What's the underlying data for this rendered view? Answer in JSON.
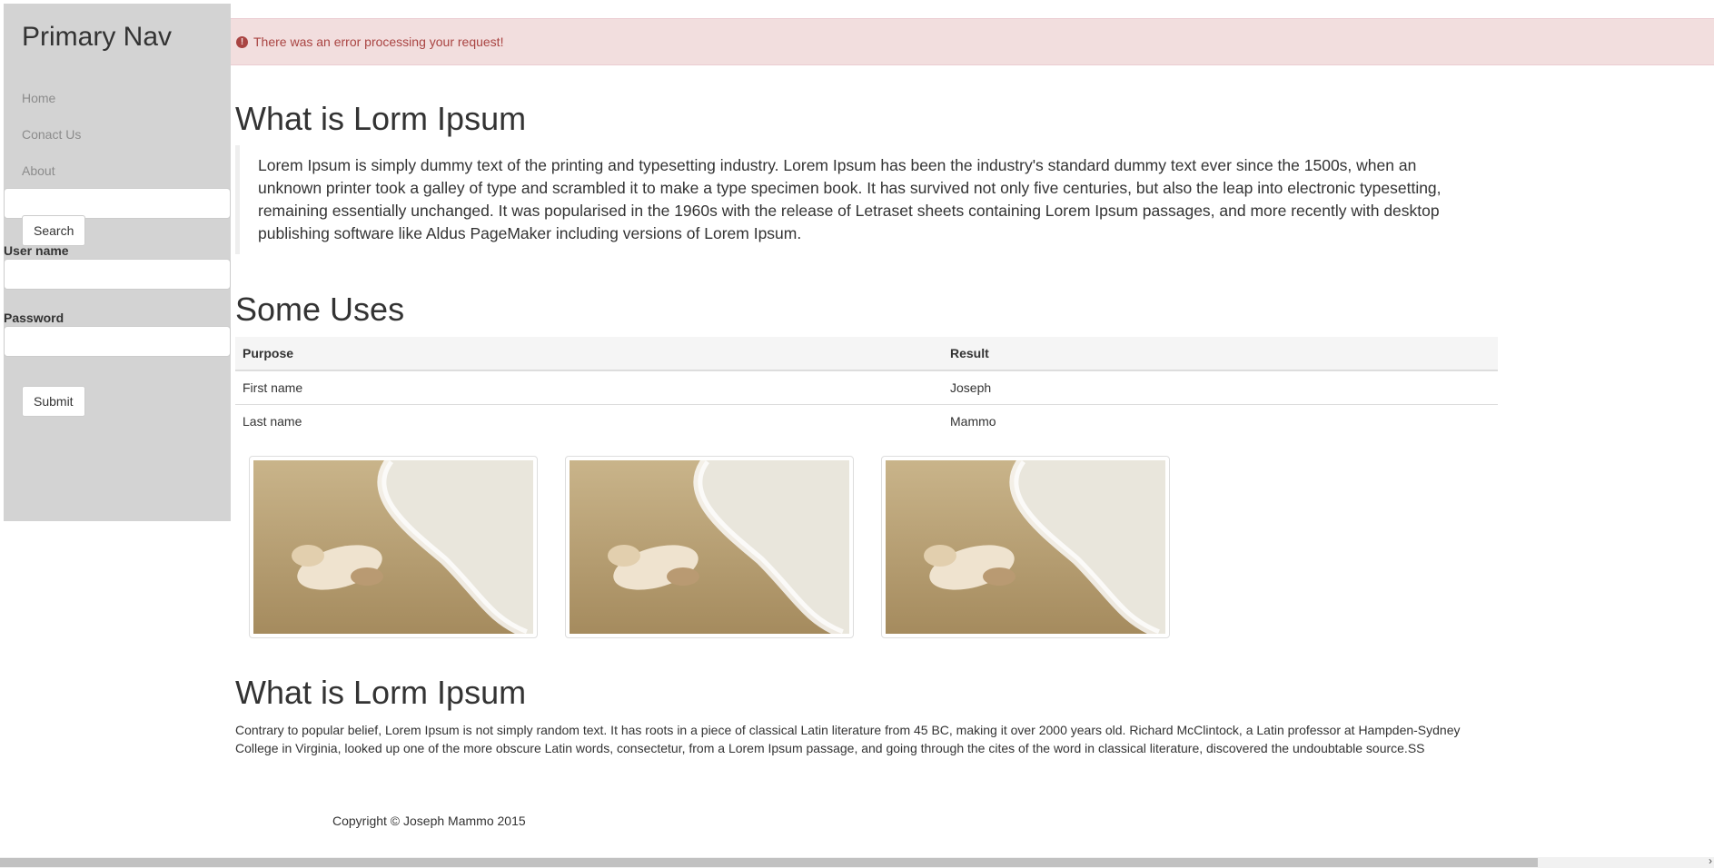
{
  "sidebar": {
    "title": "Primary Nav",
    "nav": [
      {
        "label": "Home"
      },
      {
        "label": "Conact Us"
      },
      {
        "label": "About"
      }
    ],
    "search": {
      "value": "",
      "button_label": "Search"
    },
    "login": {
      "username_label": "User name",
      "username_value": "",
      "password_label": "Password",
      "password_value": "",
      "submit_label": "Submit"
    }
  },
  "alert": {
    "icon": "exclamation-circle-icon",
    "message": "There was an error processing your request!",
    "colors": {
      "background": "#f2dede",
      "text": "#a94442"
    }
  },
  "main": {
    "section1": {
      "heading": "What is Lorm Ipsum",
      "quote": "Lorem Ipsum is simply dummy text of the printing and typesetting industry. Lorem Ipsum has been the industry's standard dummy text ever since the 1500s, when an unknown printer took a galley of type and scrambled it to make a type specimen book. It has survived not only five centuries, but also the leap into electronic typesetting, remaining essentially unchanged. It was popularised in the 1960s with the release of Letraset sheets containing Lorem Ipsum passages, and more recently with desktop publishing software like Aldus PageMaker including versions of Lorem Ipsum."
    },
    "section2": {
      "heading": "Some Uses",
      "table": {
        "headers": [
          "Purpose",
          "Result"
        ],
        "rows": [
          [
            "First name",
            "Joseph"
          ],
          [
            "Last name",
            "Mammo"
          ]
        ]
      }
    },
    "gallery": [
      {
        "image": "seashell-on-beach"
      },
      {
        "image": "seashell-on-beach"
      },
      {
        "image": "seashell-on-beach"
      }
    ],
    "section3": {
      "heading": "What is Lorm Ipsum",
      "paragraph": "Contrary to popular belief, Lorem Ipsum is not simply random text. It has roots in a piece of classical Latin literature from 45 BC, making it over 2000 years old. Richard McClintock, a Latin professor at Hampden-Sydney College in Virginia, looked up one of the more obscure Latin words, consectetur, from a Lorem Ipsum passage, and going through the cites of the word in classical literature, discovered the undoubtable source.SS"
    }
  },
  "footer": {
    "copyright": "Copyright © Joseph Mammo 2015"
  },
  "colors": {
    "sidebar_bg": "#d3d3d3",
    "nav_link": "#8c8c8c"
  }
}
